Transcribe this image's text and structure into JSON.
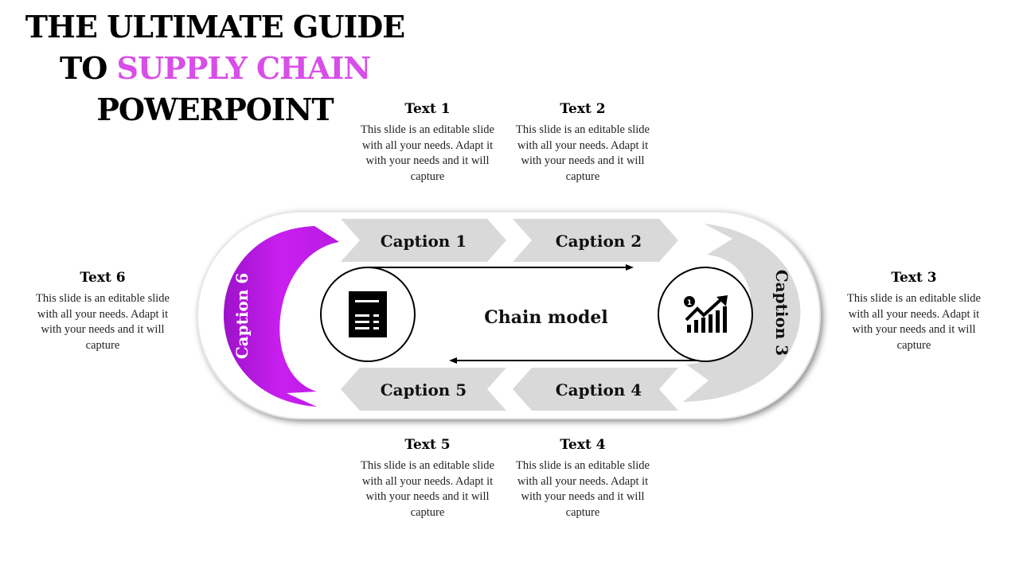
{
  "title": {
    "line1": "THE ULTIMATE GUIDE",
    "line2_prefix": "TO ",
    "line2_accent": "SUPPLY CHAIN",
    "line3": "POWERPOINT",
    "accent_color": "#d84ee8"
  },
  "center_label": "Chain model",
  "captions": {
    "c1": "Caption 1",
    "c2": "Caption 2",
    "c3": "Caption 3",
    "c4": "Caption 4",
    "c5": "Caption 5",
    "c6": "Caption 6"
  },
  "colors": {
    "highlight": "#c21fe8",
    "chevron": "#d9d9d9"
  },
  "icons": {
    "left": "document-icon",
    "right": "growth-chart-icon"
  },
  "text_blocks": [
    {
      "title": "Text 1",
      "body": "This slide is an editable slide with all your needs. Adapt it with your needs and it will capture"
    },
    {
      "title": "Text 2",
      "body": "This slide is an editable slide with all your needs. Adapt it with your needs and it will capture"
    },
    {
      "title": "Text 3",
      "body": "This slide is an editable slide with all your needs. Adapt it with your needs and it will capture"
    },
    {
      "title": "Text 4",
      "body": "This slide is an editable slide with all your needs. Adapt it with your needs and it will capture"
    },
    {
      "title": "Text 5",
      "body": "This slide is an editable slide with all your needs. Adapt it with your needs and it will capture"
    },
    {
      "title": "Text 6",
      "body": "This slide is an editable slide with all your needs. Adapt it with your needs and it will capture"
    }
  ]
}
